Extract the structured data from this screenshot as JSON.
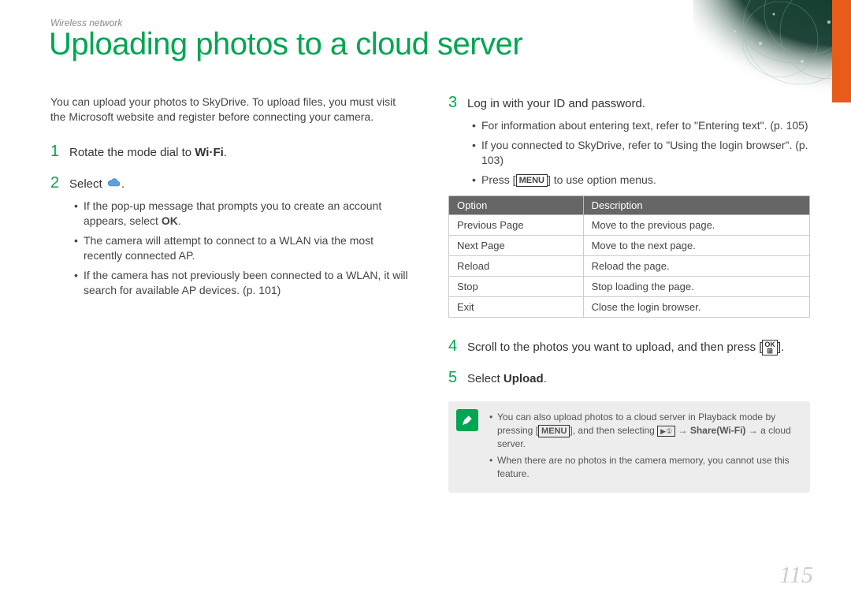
{
  "breadcrumb": "Wireless network",
  "title": "Uploading photos to a cloud server",
  "intro": "You can upload your photos to SkyDrive. To upload files, you must visit the Microsoft website and register before connecting your camera.",
  "steps": {
    "s1": {
      "num": "1",
      "text_a": "Rotate the mode dial to ",
      "wifi": "Wi·Fi",
      "text_b": "."
    },
    "s2": {
      "num": "2",
      "text_a": "Select ",
      "text_b": ".",
      "bullets": [
        {
          "a": "If the pop-up message that prompts you to create an account appears, select ",
          "bold": "OK",
          "b": "."
        },
        {
          "a": "The camera will attempt to connect to a WLAN via the most recently connected AP."
        },
        {
          "a": "If the camera has not previously been connected to a WLAN, it will search for available AP devices. (p. 101)"
        }
      ]
    },
    "s3": {
      "num": "3",
      "text": "Log in with your ID and password.",
      "bullets": [
        {
          "a": "For information about entering text, refer to \"Entering text\". (p. 105)"
        },
        {
          "a": "If you connected to SkyDrive, refer to \"Using the login browser\". (p. 103)"
        },
        {
          "a": "Press [",
          "menu": "MENU",
          "b": "] to use option menus."
        }
      ]
    },
    "s4": {
      "num": "4",
      "text_a": "Scroll to the photos you want to upload, and then press [",
      "ok_top": "OK",
      "ok_bot": "⊞",
      "text_b": "]."
    },
    "s5": {
      "num": "5",
      "text_a": "Select ",
      "bold": "Upload",
      "text_b": "."
    }
  },
  "table": {
    "head": {
      "c1": "Option",
      "c2": "Description"
    },
    "rows": [
      {
        "c1": "Previous Page",
        "c2": "Move to the previous page."
      },
      {
        "c1": "Next Page",
        "c2": "Move to the next page."
      },
      {
        "c1": "Reload",
        "c2": "Reload the page."
      },
      {
        "c1": "Stop",
        "c2": "Stop loading the page."
      },
      {
        "c1": "Exit",
        "c2": "Close the login browser."
      }
    ]
  },
  "note": {
    "items": [
      {
        "a": "You can also upload photos to a cloud server in Playback mode by pressing [",
        "menu": "MENU",
        "b": "], and then selecting ",
        "play": "▶①",
        "c": " → ",
        "bold1": "Share(Wi-Fi)",
        "d": " → a cloud server."
      },
      {
        "a": "When there are no photos in the camera memory, you cannot use this feature."
      }
    ]
  },
  "page_number": "115"
}
